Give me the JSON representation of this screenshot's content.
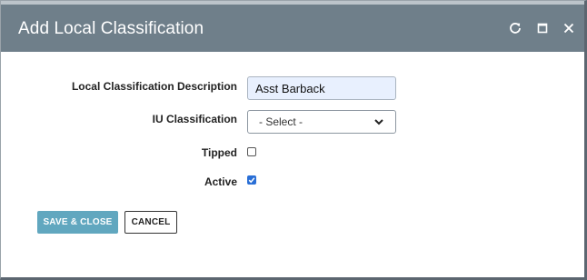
{
  "dialog": {
    "title": "Add Local Classification",
    "controls": {
      "refresh_icon": "refresh-icon",
      "maximize_icon": "maximize-icon",
      "close_icon": "close-icon"
    }
  },
  "form": {
    "description_label": "Local Classification Description",
    "description_value": "Asst Barback",
    "iu_label": "IU Classification",
    "iu_selected": "- Select -",
    "tipped_label": "Tipped",
    "tipped_checked": false,
    "active_label": "Active",
    "active_checked": true
  },
  "buttons": {
    "save_close": "SAVE & CLOSE",
    "cancel": "CANCEL"
  },
  "colors": {
    "titlebar": "#6f7f8a",
    "save_button": "#61a7bf",
    "input_fill": "#e8f0fe",
    "checkbox_checked": "#2a6fd6"
  }
}
